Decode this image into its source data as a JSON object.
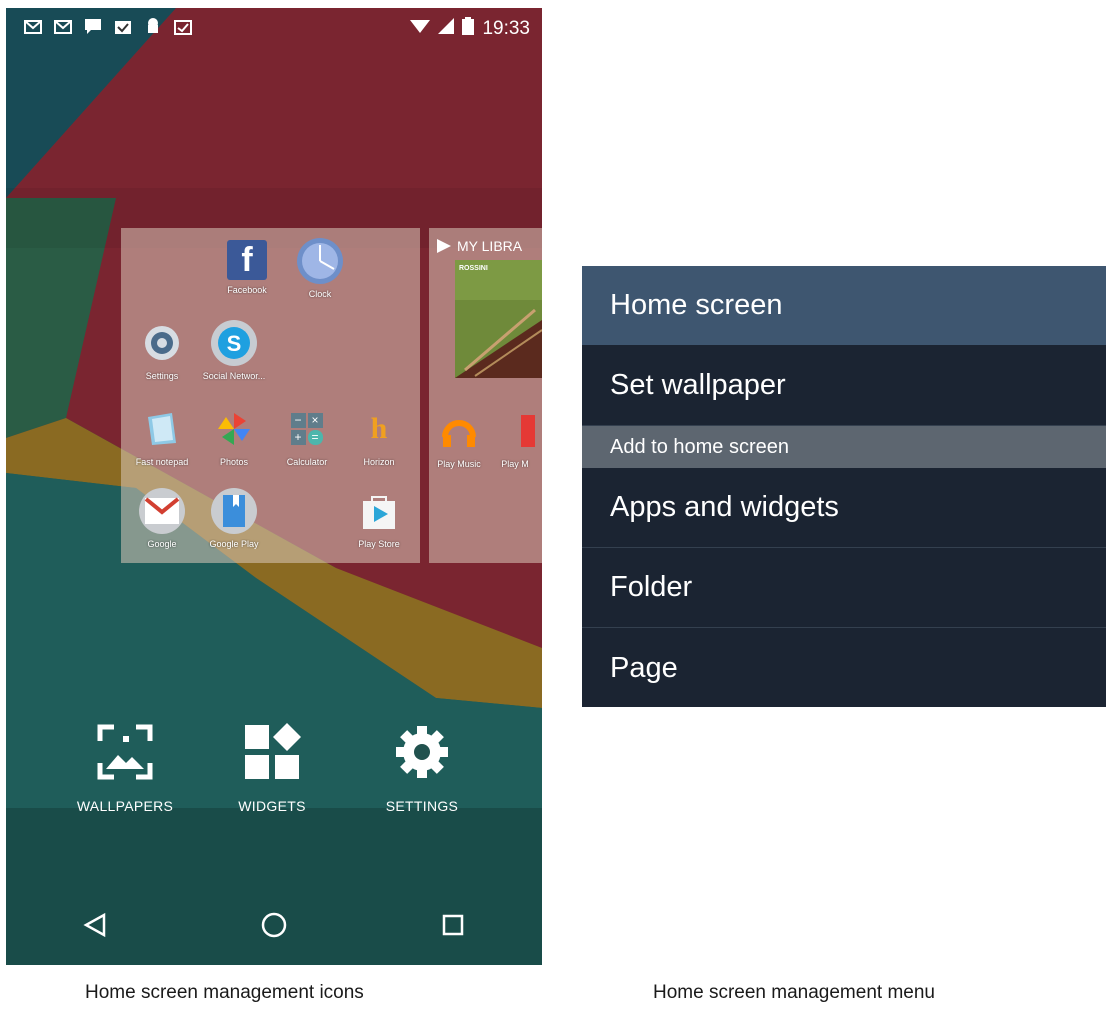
{
  "status_bar": {
    "notification_icons": [
      "gmail-icon",
      "gmail-icon",
      "hangouts-icon",
      "tasks-icon",
      "android-icon",
      "clipboard-icon"
    ],
    "time": "19:33",
    "system_icons": [
      "wifi-icon",
      "signal-icon",
      "battery-icon"
    ]
  },
  "page1": {
    "apps": [
      {
        "label": "Facebook",
        "icon": "facebook-icon"
      },
      {
        "label": "Clock",
        "icon": "clock-icon"
      },
      {
        "label": "Settings",
        "icon": "settings-icon"
      },
      {
        "label": "Social Networ...",
        "icon": "skype-icon"
      },
      {
        "label": "Fast notepad",
        "icon": "notepad-icon"
      },
      {
        "label": "Photos",
        "icon": "photos-icon"
      },
      {
        "label": "Calculator",
        "icon": "calculator-icon"
      },
      {
        "label": "Horizon",
        "icon": "horizon-icon"
      },
      {
        "label": "Google",
        "icon": "gmail-icon"
      },
      {
        "label": "Google Play",
        "icon": "google-play-books-icon"
      },
      {
        "label": "Play Store",
        "icon": "play-store-icon"
      }
    ]
  },
  "page2": {
    "library_title": "MY LIBRA",
    "album_text": "ROSSINI",
    "apps": [
      {
        "label": "Play Music",
        "icon": "play-music-icon"
      },
      {
        "label": "Play M",
        "icon": "play-movies-icon"
      }
    ]
  },
  "management": {
    "wallpapers": "WALLPAPERS",
    "widgets": "WIDGETS",
    "settings": "SETTINGS"
  },
  "nav": [
    "back-icon",
    "home-icon",
    "recents-icon"
  ],
  "captions": {
    "left": "Home screen management icons",
    "right": "Home screen management menu"
  },
  "menu": {
    "title": "Home screen",
    "set_wallpaper": "Set wallpaper",
    "section": "Add to home screen",
    "items": [
      "Apps and widgets",
      "Folder",
      "Page"
    ]
  },
  "colors": {
    "menu_header": "#3e5670",
    "menu_bg": "#1b2432",
    "menu_section": "#5d6670",
    "wallpaper_red": "#7a2530",
    "wallpaper_teal": "#1e5a55",
    "wallpaper_gold": "#8a6a22"
  }
}
